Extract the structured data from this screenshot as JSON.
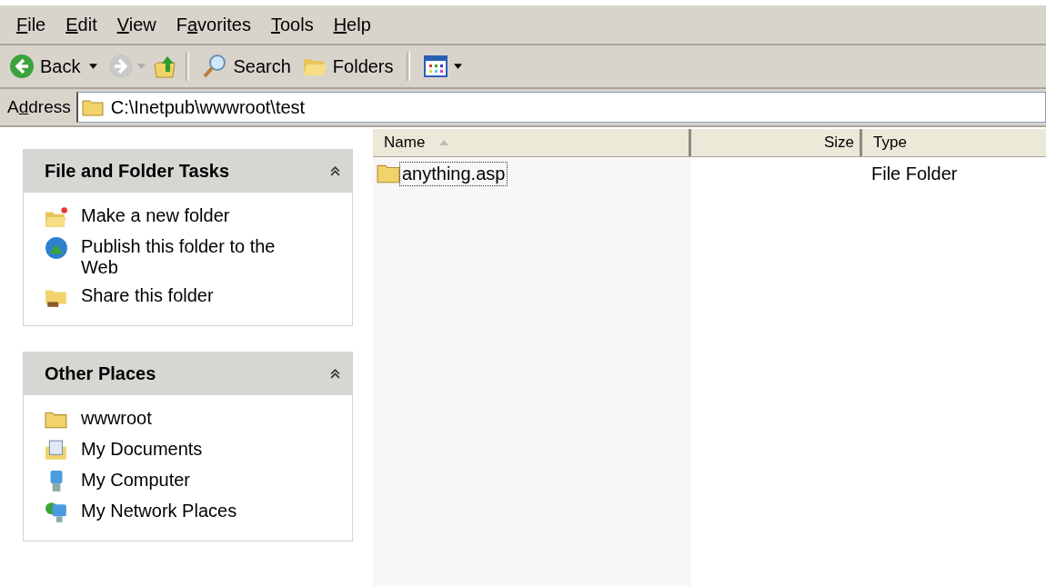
{
  "menu": [
    {
      "key": "F",
      "post": "ile"
    },
    {
      "key": "E",
      "post": "dit"
    },
    {
      "key": "V",
      "post": "iew"
    },
    {
      "pre": "F",
      "key": "a",
      "post": "vorites"
    },
    {
      "key": "T",
      "post": "ools"
    },
    {
      "key": "H",
      "post": "elp"
    }
  ],
  "toolbar": {
    "back": "Back",
    "forward_disabled": true,
    "search": "Search",
    "folders": "Folders"
  },
  "address": {
    "label": {
      "pre": "A",
      "key": "d",
      "post": "dress"
    },
    "value": "C:\\Inetpub\\wwwroot\\test"
  },
  "panels": [
    {
      "title": "File and Folder Tasks",
      "expanded": true,
      "items": [
        {
          "label": "Make a new folder",
          "kind": "newfolder"
        },
        {
          "label": "Publish this folder to the Web",
          "kind": "publish"
        },
        {
          "label": "Share this folder",
          "kind": "share"
        }
      ]
    },
    {
      "title": "Other Places",
      "expanded": true,
      "items": [
        {
          "label": "wwwroot",
          "kind": "folder"
        },
        {
          "label": "My Documents",
          "kind": "documents"
        },
        {
          "label": "My Computer",
          "kind": "computer"
        },
        {
          "label": "My Network Places",
          "kind": "network"
        }
      ]
    }
  ],
  "columns": [
    {
      "label": "Name",
      "sorted": true
    },
    {
      "label": "Size",
      "sorted": false
    },
    {
      "label": "Type",
      "sorted": false
    }
  ],
  "rows": [
    {
      "name": "anything.asp",
      "type": "File Folder",
      "focused": true
    }
  ]
}
